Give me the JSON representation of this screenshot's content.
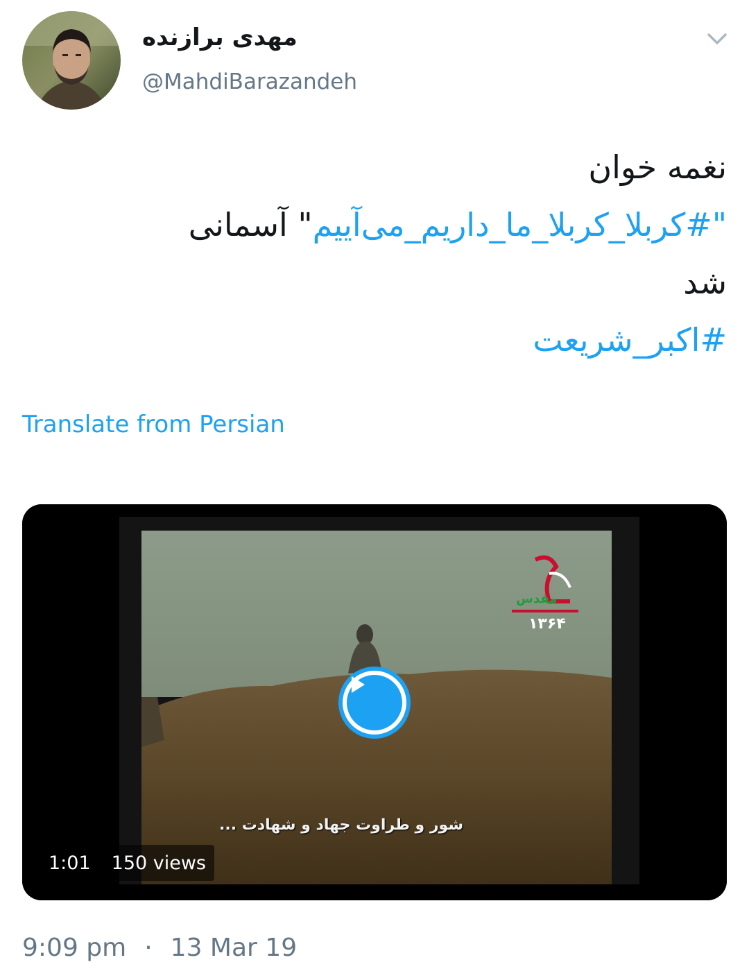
{
  "author": {
    "display_name": "مهدی برازنده",
    "handle": "@MahdiBarazandeh"
  },
  "tweet": {
    "line1": "نغمه خوان",
    "line2_quote_open": "\"",
    "line2_hashtag": "#کربلا_کربلا_ما_داریم_می‌آییم",
    "line2_after": "\" آسمانی",
    "line3": "شد",
    "line4_hashtag": "#اکبر_شریعت"
  },
  "translate_label": "Translate from Persian",
  "media": {
    "duration": "1:01",
    "views": "150 views",
    "subtitle": "شور و طراوت جهاد و شهادت ...",
    "logo_year": "۱۳۶۴"
  },
  "timestamp": {
    "time": "9:09 pm",
    "separator": "·",
    "date": "13 Mar 19"
  },
  "colors": {
    "link": "#1da1f2",
    "secondary_text": "#657786"
  },
  "icons": {
    "chevron": "chevron-down-icon",
    "play": "play-icon"
  }
}
